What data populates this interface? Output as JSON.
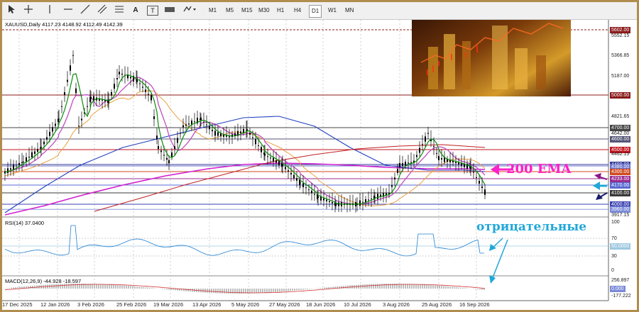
{
  "toolbar": {
    "timeframes": [
      {
        "label": "M1",
        "active": false
      },
      {
        "label": "M5",
        "active": false
      },
      {
        "label": "M15",
        "active": false
      },
      {
        "label": "M30",
        "active": false
      },
      {
        "label": "H1",
        "active": false
      },
      {
        "label": "H4",
        "active": false
      },
      {
        "label": "D1",
        "active": true
      },
      {
        "label": "W1",
        "active": false
      },
      {
        "label": "MN",
        "active": false
      }
    ],
    "tools": {
      "text_tool": "A",
      "label_tool": "T"
    }
  },
  "chart": {
    "title": "XAUUSD,Daily  4117.23 4148.92 4112.49 4142.39",
    "price_labels": [
      {
        "value": "5602.00",
        "kind": "box",
        "color": "#8b1a1a"
      },
      {
        "value": "5552.15",
        "kind": "plain"
      },
      {
        "value": "5366.85",
        "kind": "plain"
      },
      {
        "value": "5187.00",
        "kind": "plain"
      },
      {
        "value": "5000.00",
        "kind": "box",
        "color": "#8b1a1a"
      },
      {
        "value": "4821.65",
        "kind": "plain"
      },
      {
        "value": "4700.00",
        "kind": "box",
        "color": "#444444"
      },
      {
        "value": "4642.00",
        "kind": "plain"
      },
      {
        "value": "4600.00",
        "kind": "box",
        "color": "#555577"
      },
      {
        "value": "4500.00",
        "kind": "box",
        "color": "#c0141c"
      },
      {
        "value": "4462.15",
        "kind": "plain"
      },
      {
        "value": "4400.00",
        "kind": "box",
        "color": "#333a99"
      },
      {
        "value": "4380.00",
        "kind": "box",
        "color": "#6a72c8"
      },
      {
        "value": "4300.00",
        "kind": "box",
        "color": "#d04a20"
      },
      {
        "value": "4233.00",
        "kind": "box",
        "color": "#9b2d8f"
      },
      {
        "value": "4170.00",
        "kind": "box",
        "color": "#5a6ad0"
      },
      {
        "value": "4100.00",
        "kind": "box",
        "color": "#3a3a3a"
      },
      {
        "value": "4000.00",
        "kind": "box",
        "color": "#3a40b0"
      },
      {
        "value": "3960.00",
        "kind": "box",
        "color": "#7a8ad8"
      },
      {
        "value": "3917.15",
        "kind": "plain"
      }
    ],
    "x_labels": [
      "17 Dec 2025",
      "12 Jan 2026",
      "3 Feb 2026",
      "25 Feb 2026",
      "19 Mar 2026",
      "13 Apr 2026",
      "5 May 2026",
      "27 May 2026",
      "18 Jun 2026",
      "10 Jul 2026",
      "3 Aug 2026",
      "25 Aug 2026",
      "16 Sep 2026"
    ]
  },
  "rsi": {
    "title": "RSI(14) 37.0400",
    "levels": [
      "100",
      "70",
      "50.0000",
      "30",
      "0"
    ]
  },
  "macd": {
    "title": "MACD(12,26,9) -44.928 -18.597",
    "levels": [
      "256.897",
      "0.000",
      "-177.222"
    ]
  },
  "annotations": {
    "ema_label": "200 EMA",
    "negative_label": "отрицательные"
  },
  "colors": {
    "price_green": "#0a8a0a",
    "ema_magenta": "#d020d0",
    "ema_blue": "#2040c0",
    "ema_orange": "#e8a040",
    "ema_red": "#c02020",
    "annotation_magenta": "#ff20c8",
    "annotation_cyan": "#20a8d8"
  }
}
